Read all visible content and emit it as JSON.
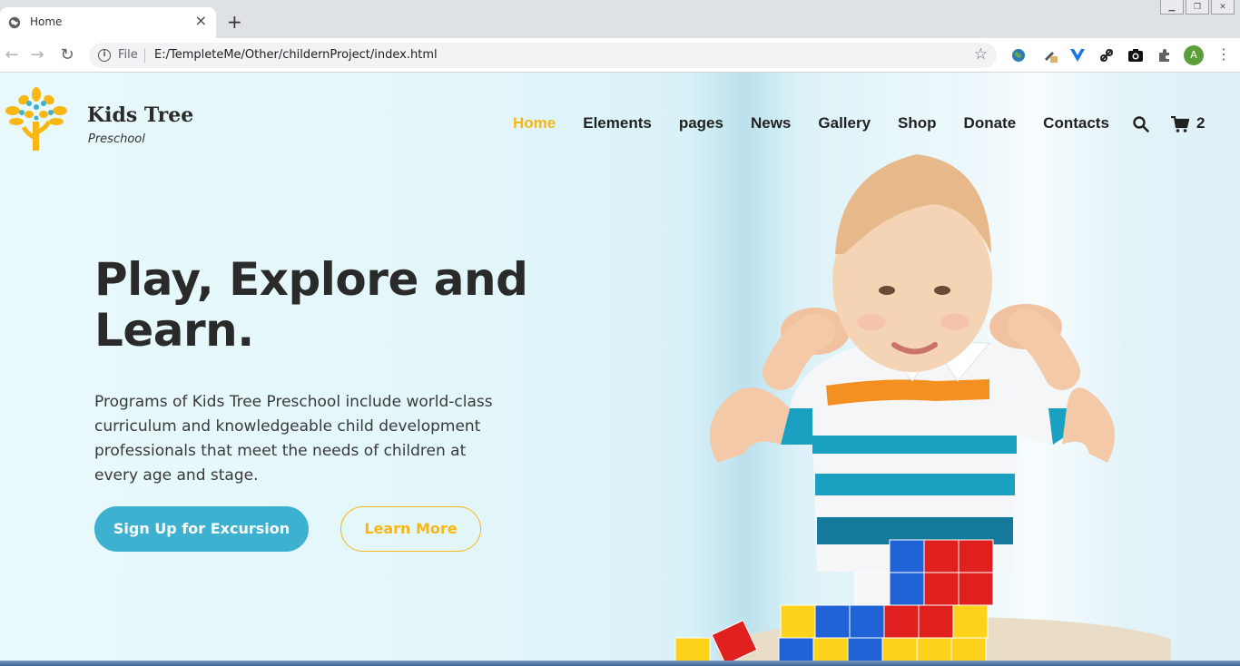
{
  "browser": {
    "tab": {
      "title": "Home",
      "close": "×"
    },
    "new_tab": "+",
    "window_controls": [
      "▁",
      "❐",
      "✕"
    ],
    "nav": {
      "back": "←",
      "forward": "→",
      "reload": "↻"
    },
    "omnibox": {
      "info": "i",
      "scheme_label": "File",
      "url": "E:/TempleteMe/Other/childernProject/index.html",
      "star": "☆"
    },
    "profile_initial": "A",
    "menu": "⋮",
    "extension_icons": [
      "globe-extension-icon",
      "dropper-extension-icon",
      "vue-extension-icon",
      "link-extension-icon",
      "camera-extension-icon",
      "puzzle-extension-icon"
    ]
  },
  "site": {
    "brand": {
      "name": "Kids Tree",
      "tagline": "Preschool"
    },
    "nav": [
      {
        "label": "Home",
        "active": true
      },
      {
        "label": "Elements"
      },
      {
        "label": "pages"
      },
      {
        "label": "News"
      },
      {
        "label": "Gallery"
      },
      {
        "label": "Shop"
      },
      {
        "label": "Donate"
      },
      {
        "label": "Contacts"
      }
    ],
    "cart_count": "2",
    "hero": {
      "title": "Play, Explore and Learn.",
      "text": "Programs of Kids Tree Preschool include world-class curriculum and knowledgeable child development professionals that meet the needs of children at every age and stage.",
      "primary_cta": "Sign Up for Excursion",
      "secondary_cta": "Learn More"
    }
  },
  "colors": {
    "accent": "#f8b715",
    "primary": "#3db1cf",
    "text": "#2a2a2a"
  }
}
